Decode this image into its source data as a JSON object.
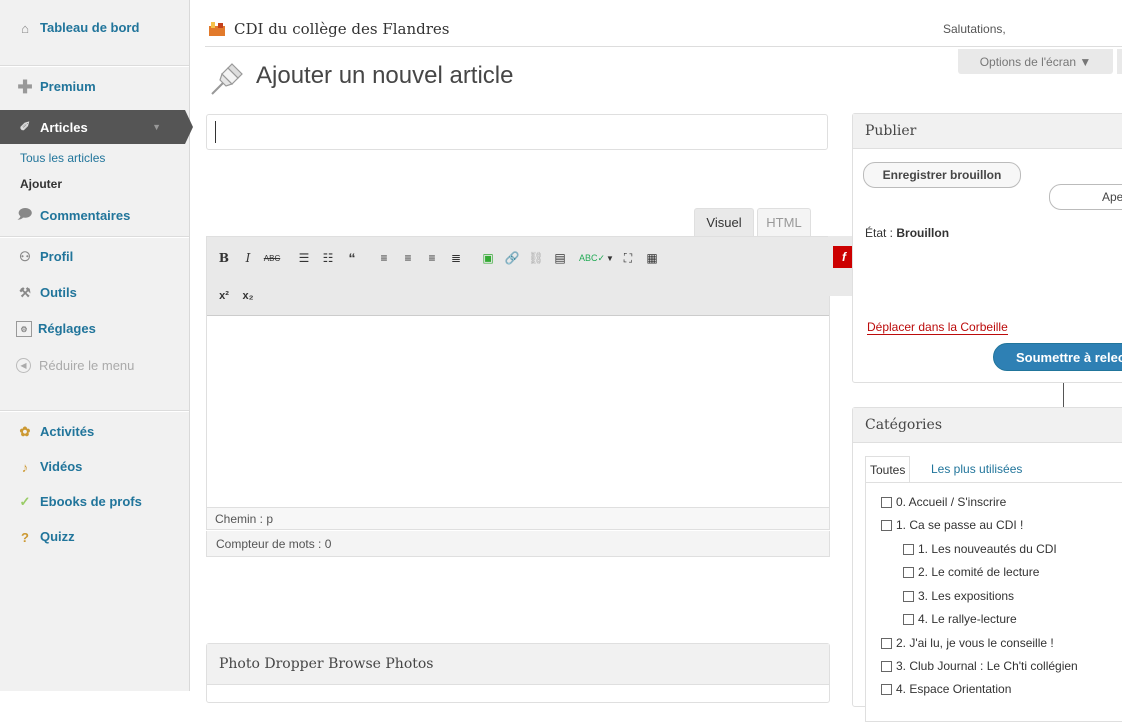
{
  "sidebar": {
    "dashboard": "Tableau de bord",
    "premium": "Premium",
    "articles": "Articles",
    "articles_sub": [
      "Tous les articles",
      "Ajouter"
    ],
    "comments": "Commentaires",
    "profile": "Profil",
    "tools": "Outils",
    "settings": "Réglages",
    "collapse": "Réduire le menu",
    "activities": "Activités",
    "videos": "Vidéos",
    "ebooks": "Ebooks de profs",
    "quiz": "Quizz"
  },
  "header": {
    "site_name": "CDI du collège des Flandres",
    "greeting": "Salutations,",
    "screen_options": "Options de l'écran ▼",
    "page_title": "Ajouter un nouvel article"
  },
  "editor": {
    "tab_visual": "Visuel",
    "tab_html": "HTML",
    "path": "Chemin : p",
    "word_count": "Compteur de mots : 0",
    "title_value": ""
  },
  "publish": {
    "title": "Publier",
    "save_draft": "Enregistrer brouillon",
    "preview": "Aperç",
    "status_label": "État : ",
    "status_value": "Brouillon",
    "trash": "Déplacer dans la Corbeille",
    "submit": "Soumettre à relec"
  },
  "categories": {
    "title": "Catégories",
    "tab_all": "Toutes",
    "tab_popular": "Les plus utilisées",
    "items": [
      "0. Accueil / S'inscrire",
      "1. Ca se passe au CDI !",
      "1. Les nouveautés du CDI",
      "2. Le comité de lecture",
      "3. Les expositions",
      "4. Le rallye-lecture",
      "2. J'ai lu, je vous le conseille !",
      "3. Club Journal : Le Ch'ti collégien",
      "4. Espace Orientation"
    ]
  },
  "photo_dropper": {
    "title": "Photo Dropper Browse Photos"
  }
}
